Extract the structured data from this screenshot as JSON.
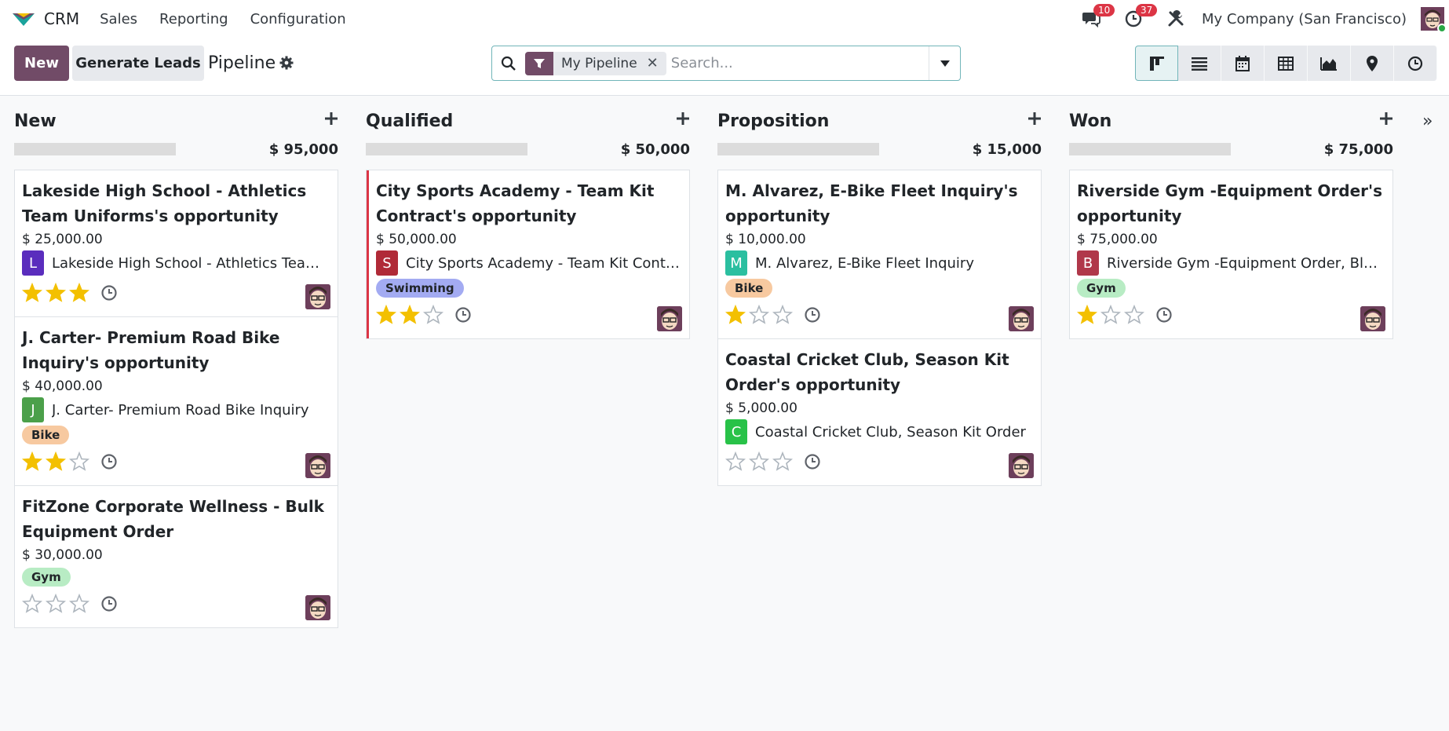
{
  "navbar": {
    "app_name": "CRM",
    "menu": [
      "Sales",
      "Reporting",
      "Configuration"
    ],
    "messages_count": "10",
    "activities_count": "37",
    "company": "My Company (San Francisco)"
  },
  "control": {
    "new_label": "New",
    "generate_label": "Generate Leads",
    "title": "Pipeline",
    "facet_label": "My Pipeline",
    "search_placeholder": "Search..."
  },
  "colors": {
    "brand": "#714b67",
    "accent": "#71b5b9",
    "danger": "#dc3545",
    "star": "#f3c000"
  },
  "columns": [
    {
      "title": "New",
      "total": "$ 95,000",
      "cards": [
        {
          "title": "Lakeside High School - Athletics Team Uniforms's opportunity",
          "amount": "$ 25,000.00",
          "partner_initial": "L",
          "partner_color": "#5a2dbd",
          "partner": "Lakeside High School - Athletics Team Uniforms",
          "tag": "",
          "stars": 3
        },
        {
          "title": "J. Carter- Premium Road Bike Inquiry's opportunity",
          "amount": "$ 40,000.00",
          "partner_initial": "J",
          "partner_color": "#4ba04a",
          "partner": "J. Carter- Premium Road Bike Inquiry",
          "tag": "Bike",
          "stars": 2
        },
        {
          "title": "FitZone Corporate Wellness - Bulk Equipment Order",
          "amount": "$ 30,000.00",
          "partner_initial": "",
          "partner_color": "",
          "partner": "",
          "tag": "Gym",
          "stars": 0
        }
      ]
    },
    {
      "title": "Qualified",
      "total": "$ 50,000",
      "cards": [
        {
          "title": "City Sports Academy - Team Kit Contract's opportunity",
          "amount": "$ 50,000.00",
          "partner_initial": "S",
          "partner_color": "#b02a37",
          "partner": "City Sports Academy - Team Kit Contract",
          "tag": "Swimming",
          "stars": 2,
          "red": true
        }
      ]
    },
    {
      "title": "Proposition",
      "total": "$ 15,000",
      "cards": [
        {
          "title": "M. Alvarez, E-Bike Fleet Inquiry's opportunity",
          "amount": "$ 10,000.00",
          "partner_initial": "M",
          "partner_color": "#2bbfa0",
          "partner": "M. Alvarez, E-Bike Fleet Inquiry",
          "tag": "Bike",
          "stars": 1
        },
        {
          "title": "Coastal Cricket Club, Season Kit Order's opportunity",
          "amount": "$ 5,000.00",
          "partner_initial": "C",
          "partner_color": "#28c248",
          "partner": "Coastal Cricket Club, Season Kit Order",
          "tag": "",
          "stars": 0
        }
      ]
    },
    {
      "title": "Won",
      "total": "$ 75,000",
      "cards": [
        {
          "title": "Riverside Gym -Equipment Order's opportunity",
          "amount": "$ 75,000.00",
          "partner_initial": "B",
          "partner_color": "#b0384a",
          "partner": "Riverside Gym -Equipment Order, Blake",
          "tag": "Gym",
          "stars": 1
        }
      ]
    }
  ],
  "tag_colors": {
    "Bike": {
      "bg": "#f7c9a0",
      "fg": "#212529"
    },
    "Gym": {
      "bg": "#b8ecc4",
      "fg": "#212529"
    },
    "Swimming": {
      "bg": "#a3abf2",
      "fg": "#212529"
    }
  }
}
